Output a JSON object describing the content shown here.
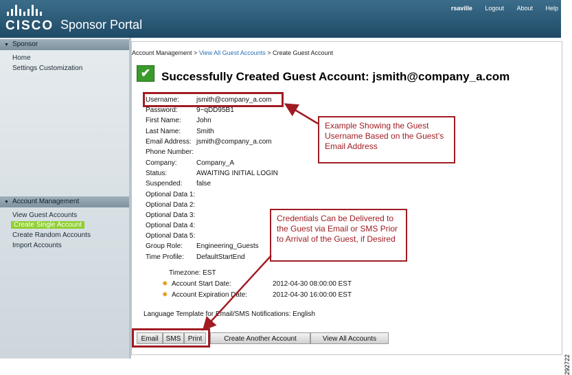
{
  "header": {
    "brand": "CISCO",
    "title": "Sponsor Portal",
    "nav": {
      "user": "rsaville",
      "logout": "Logout",
      "about": "About",
      "help": "Help"
    },
    "colors": {
      "bar_top": "#3b6d8a",
      "bar_bottom": "#1f4a66"
    }
  },
  "sidebar": {
    "sponsor_section": {
      "title": "Sponsor",
      "items": [
        {
          "label": "Home"
        },
        {
          "label": "Settings Customization"
        }
      ]
    },
    "account_section": {
      "title": "Account Management",
      "items": [
        {
          "label": "View Guest Accounts"
        },
        {
          "label": "Create Single Account",
          "selected": true
        },
        {
          "label": "Create Random Accounts"
        },
        {
          "label": "Import Accounts"
        }
      ]
    },
    "selected_color": "#8fcf2f"
  },
  "breadcrumb": {
    "part1": "Account Management >",
    "part2": "View All Guest Accounts",
    "part3": "> Create Guest Account"
  },
  "success": {
    "heading": "Successfully Created Guest Account:  jsmith@company_a.com",
    "icon": "checkmark-icon"
  },
  "fields": [
    {
      "label": "Username:",
      "value": "jsmith@company_a.com"
    },
    {
      "label": "Password:",
      "value": "9~qDD95B1"
    },
    {
      "label": "First Name:",
      "value": "John"
    },
    {
      "label": "Last Name:",
      "value": "Smith"
    },
    {
      "label": "Email Address:",
      "value": "jsmith@company_a.com"
    },
    {
      "label": "Phone Number:",
      "value": ""
    },
    {
      "label": "Company:",
      "value": "Company_A"
    },
    {
      "label": "Status:",
      "value": "AWAITING INITIAL LOGIN"
    },
    {
      "label": "Suspended:",
      "value": "false"
    },
    {
      "label": "Optional Data 1:",
      "value": ""
    },
    {
      "label": "Optional Data 2:",
      "value": ""
    },
    {
      "label": "Optional Data 3:",
      "value": ""
    },
    {
      "label": "Optional Data 4:",
      "value": ""
    },
    {
      "label": "Optional Data 5:",
      "value": ""
    },
    {
      "label": "Group Role:",
      "value": "Engineering_Guests"
    },
    {
      "label": "Time Profile:",
      "value": "DefaultStartEnd"
    }
  ],
  "timezone": "Timezone: EST",
  "dates": [
    {
      "label": "Account Start Date:",
      "value": "2012-04-30 08:00:00 EST",
      "icon": "gear-icon"
    },
    {
      "label": "Account Expiration Date:",
      "value": "2012-04-30 16:00:00 EST",
      "icon": "gear-icon"
    }
  ],
  "language_template": "Language Template for Email/SMS Notifications: English",
  "buttons": {
    "email": "Email",
    "sms": "SMS",
    "print": "Print",
    "create_another": "Create Another Account",
    "view_all": "View All Accounts"
  },
  "callouts": {
    "username": "Example Showing  the Guest Username  Based on the Guest’s Email Address",
    "credentials": "Credentials Can  be Delivered to the Guest via Email or SMS Prior to Arrival of the Guest, if Desired",
    "color": "#a01c22"
  },
  "figure_id": "292722"
}
